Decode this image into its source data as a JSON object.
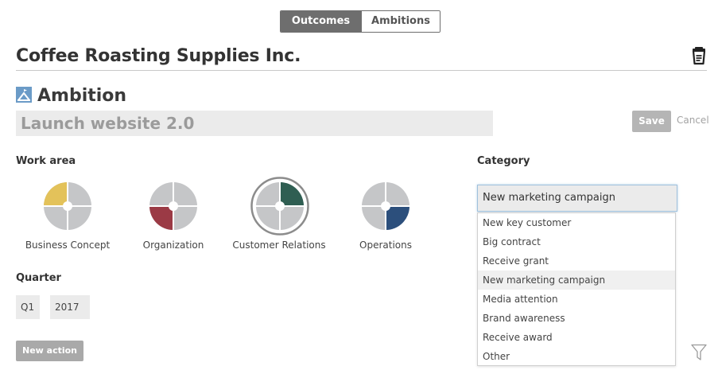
{
  "tabs": {
    "outcomes": "Outcomes",
    "ambitions": "Ambitions"
  },
  "company": "Coffee Roasting Supplies Inc.",
  "ambition": {
    "heading": "Ambition",
    "title_value": "Launch website 2.0"
  },
  "actions": {
    "save": "Save",
    "cancel": "Cancel",
    "new_action": "New action"
  },
  "work_area": {
    "label": "Work area",
    "items": [
      {
        "label": "Business Concept",
        "accent": "#e3c25a",
        "selected": false
      },
      {
        "label": "Organization",
        "accent": "#9b3a45",
        "selected": false
      },
      {
        "label": "Customer Relations",
        "accent": "#2f5e52",
        "selected": true
      },
      {
        "label": "Operations",
        "accent": "#2c4f7c",
        "selected": false
      }
    ]
  },
  "quarter": {
    "label": "Quarter",
    "q": "Q1",
    "year": "2017"
  },
  "category": {
    "label": "Category",
    "selected": "New marketing campaign",
    "options": [
      "New key customer",
      "Big contract",
      "Receive grant",
      "New marketing campaign",
      "Media attention",
      "Brand awareness",
      "Receive award",
      "Other"
    ]
  },
  "icons": {
    "cup": "coffee-cup-icon",
    "ambition": "ambition-icon",
    "filter": "filter-icon"
  }
}
